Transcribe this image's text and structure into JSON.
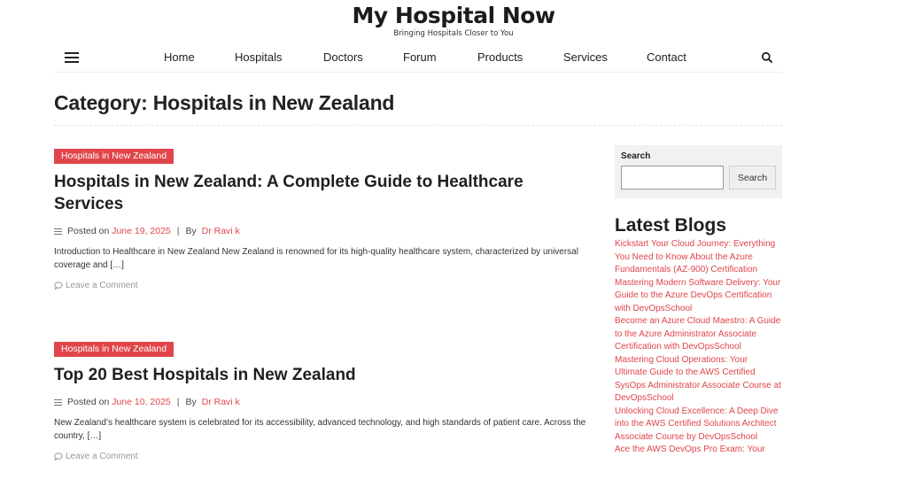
{
  "site": {
    "title": "My Hospital Now",
    "tagline": "Bringing Hospitals Closer to You"
  },
  "nav": {
    "menu_icon": "hamburger-menu-icon",
    "search_icon": "search-icon",
    "items": [
      {
        "label": "Home"
      },
      {
        "label": "Hospitals"
      },
      {
        "label": "Doctors"
      },
      {
        "label": "Forum"
      },
      {
        "label": "Products"
      },
      {
        "label": "Services"
      },
      {
        "label": "Contact"
      }
    ]
  },
  "page": {
    "category_title": "Category: Hospitals in New Zealand"
  },
  "posts": [
    {
      "category": "Hospitals in New Zealand",
      "title": "Hospitals in New Zealand: A Complete Guide to Healthcare Services",
      "posted_on_label": "Posted on",
      "date": "June 19, 2025",
      "by_label": "By",
      "author": "Dr Ravi k",
      "excerpt": "Introduction to Healthcare in New Zealand New Zealand is renowned for its high-quality healthcare system, characterized by universal coverage and […]",
      "comment_label": "Leave a Comment"
    },
    {
      "category": "Hospitals in New Zealand",
      "title": "Top 20 Best Hospitals in New Zealand",
      "posted_on_label": "Posted on",
      "date": "June 10, 2025",
      "by_label": "By",
      "author": "Dr Ravi k",
      "excerpt": "New Zealand’s healthcare system is celebrated for its accessibility, advanced technology, and high standards of patient care. Across the country, […]",
      "comment_label": "Leave a Comment"
    }
  ],
  "sidebar": {
    "search_label": "Search",
    "search_placeholder": "",
    "search_button": "Search",
    "latest_title": "Latest Blogs",
    "latest_items": [
      "Kickstart Your Cloud Journey: Everything You Need to Know About the Azure Fundamentals (AZ-900) Certification",
      "Mastering Modern Software Delivery: Your Guide to the Azure DevOps Certification with DevOpsSchool",
      "Become an Azure Cloud Maestro: A Guide to the Azure Administrator Associate Certification with DevOpsSchool",
      "Mastering Cloud Operations: Your Ultimate Guide to the AWS Certified SysOps Administrator Associate Course at DevOpsSchool",
      "Unlocking Cloud Excellence: A Deep Dive into the AWS Certified Solutions Architect Associate Course by DevOpsSchool",
      "Ace the AWS DevOps Pro Exam: Your"
    ]
  },
  "colors": {
    "accent": "#e0454a",
    "text": "#222222",
    "widget_bg": "#f1f1f1"
  }
}
